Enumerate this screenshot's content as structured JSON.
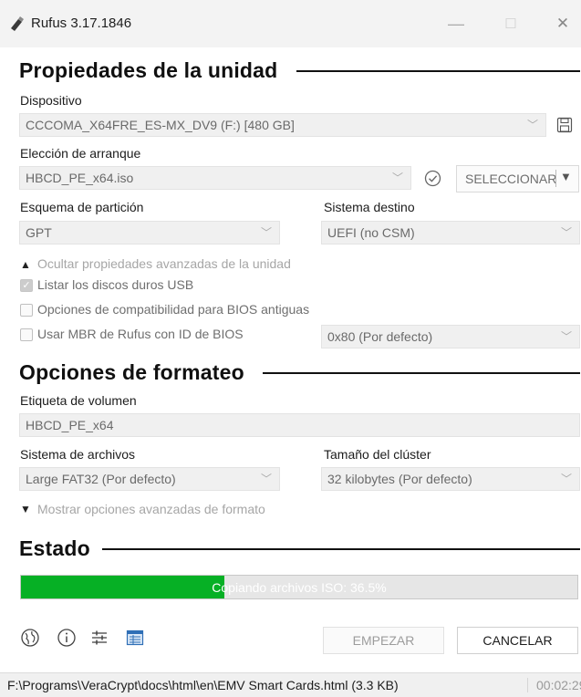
{
  "window": {
    "title": "Rufus 3.17.1846",
    "minimize": "—",
    "maximize": "☐",
    "close": "✕"
  },
  "drive": {
    "section_title": "Propiedades de la unidad",
    "device_label": "Dispositivo",
    "device_value": "CCCOMA_X64FRE_ES-MX_DV9 (F:) [480 GB]",
    "boot_label": "Elección de arranque",
    "boot_value": "HBCD_PE_x64.iso",
    "select_button": "SELECCIONAR",
    "partition_label": "Esquema de partición",
    "partition_value": "GPT",
    "target_label": "Sistema destino",
    "target_value": "UEFI (no CSM)",
    "advanced_toggle": "Ocultar propiedades avanzadas de la unidad",
    "list_usb": {
      "label": "Listar los discos duros USB",
      "checked": true
    },
    "bios_compat": {
      "label": "Opciones de compatibilidad para BIOS antiguas",
      "checked": false
    },
    "mbr_bios": {
      "label": "Usar MBR de Rufus con ID de BIOS",
      "checked": false
    },
    "bios_id_value": "0x80 (Por defecto)"
  },
  "format": {
    "section_title": "Opciones de formateo",
    "volume_label_label": "Etiqueta de volumen",
    "volume_label_value": "HBCD_PE_x64",
    "filesystem_label": "Sistema de archivos",
    "filesystem_value": "Large FAT32 (Por defecto)",
    "cluster_label": "Tamaño del clúster",
    "cluster_value": "32 kilobytes (Por defecto)",
    "advanced_toggle": "Mostrar opciones avanzadas de formato"
  },
  "status": {
    "section_title": "Estado",
    "progress_text": "Copiando archivos ISO: 36.5%",
    "progress_percent": 36.5,
    "progress_color": "#06b025"
  },
  "toolbar": {
    "icons": [
      "language-icon",
      "info-icon",
      "settings-icon",
      "log-icon"
    ],
    "start_button": "EMPEZAR",
    "cancel_button": "CANCELAR"
  },
  "statusbar": {
    "message": "F:\\Programs\\VeraCrypt\\docs\\html\\en\\EMV Smart Cards.html (3.3 KB)",
    "time": "00:02:29"
  }
}
